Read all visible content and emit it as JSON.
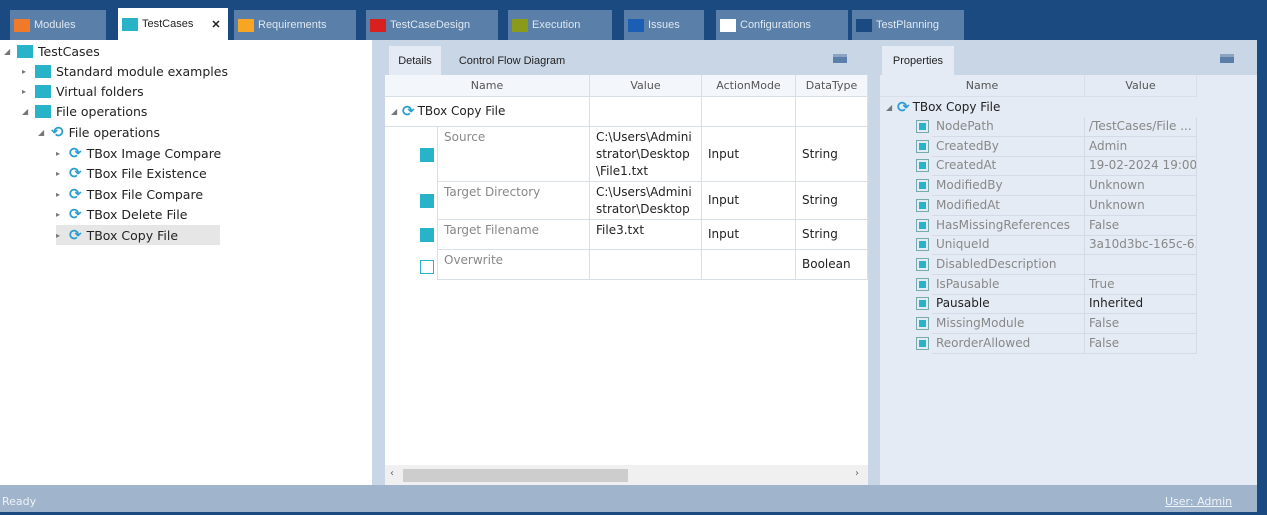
{
  "tabs": [
    {
      "label": "Modules",
      "color": "#f07a2a"
    },
    {
      "label": "TestCases",
      "color": "#29b3c9",
      "close": "✕"
    },
    {
      "label": "Requirements",
      "color": "#f6a623"
    },
    {
      "label": "TestCaseDesign",
      "color": "#d8201e"
    },
    {
      "label": "Execution",
      "color": "#8a9a1a"
    },
    {
      "label": "Issues",
      "color": "#1a5fb4"
    },
    {
      "label": "Configurations",
      "color": "#ffffff"
    },
    {
      "label": "TestPlanning",
      "color": "#1b4a80"
    }
  ],
  "tree": {
    "root": "TestCases",
    "items": [
      "Standard module examples",
      "Virtual folders",
      "File operations"
    ],
    "folder": "File operations",
    "children": [
      "TBox Image Compare",
      "TBox File Existence",
      "TBox File Compare",
      "TBox Delete File",
      "TBox Copy File"
    ]
  },
  "details": {
    "tabs": [
      "Details",
      "Control Flow Diagram"
    ],
    "columns": [
      "Name",
      "Value",
      "ActionMode",
      "DataType"
    ],
    "root": "TBox Copy File",
    "rows": [
      {
        "name": "Source",
        "value": "C:\\Users\\Administrator\\Desktop\\File1.txt",
        "mode": "Input",
        "type": "String"
      },
      {
        "name": "Target Directory",
        "value": "C:\\Users\\Administrator\\Desktop",
        "mode": "Input",
        "type": "String"
      },
      {
        "name": "Target Filename",
        "value": "File3.txt",
        "mode": "Input",
        "type": "String"
      },
      {
        "name": "Overwrite",
        "value": "",
        "mode": "",
        "type": "Boolean"
      }
    ]
  },
  "properties": {
    "tab": "Properties",
    "columns": [
      "Name",
      "Value"
    ],
    "root": "TBox Copy File",
    "rows": [
      {
        "name": "NodePath",
        "value": "/TestCases/File ..."
      },
      {
        "name": "CreatedBy",
        "value": "Admin"
      },
      {
        "name": "CreatedAt",
        "value": "19-02-2024 19:00..."
      },
      {
        "name": "ModifiedBy",
        "value": "Unknown"
      },
      {
        "name": "ModifiedAt",
        "value": "Unknown"
      },
      {
        "name": "HasMissingReferences",
        "value": "False"
      },
      {
        "name": "UniqueId",
        "value": "3a10d3bc-165c-6..."
      },
      {
        "name": "DisabledDescription",
        "value": ""
      },
      {
        "name": "IsPausable",
        "value": "True"
      },
      {
        "name": "Pausable",
        "value": "Inherited"
      },
      {
        "name": "MissingModule",
        "value": "False"
      },
      {
        "name": "ReorderAllowed",
        "value": "False"
      }
    ]
  },
  "status": {
    "text": "Ready",
    "user": "User: Admin"
  }
}
